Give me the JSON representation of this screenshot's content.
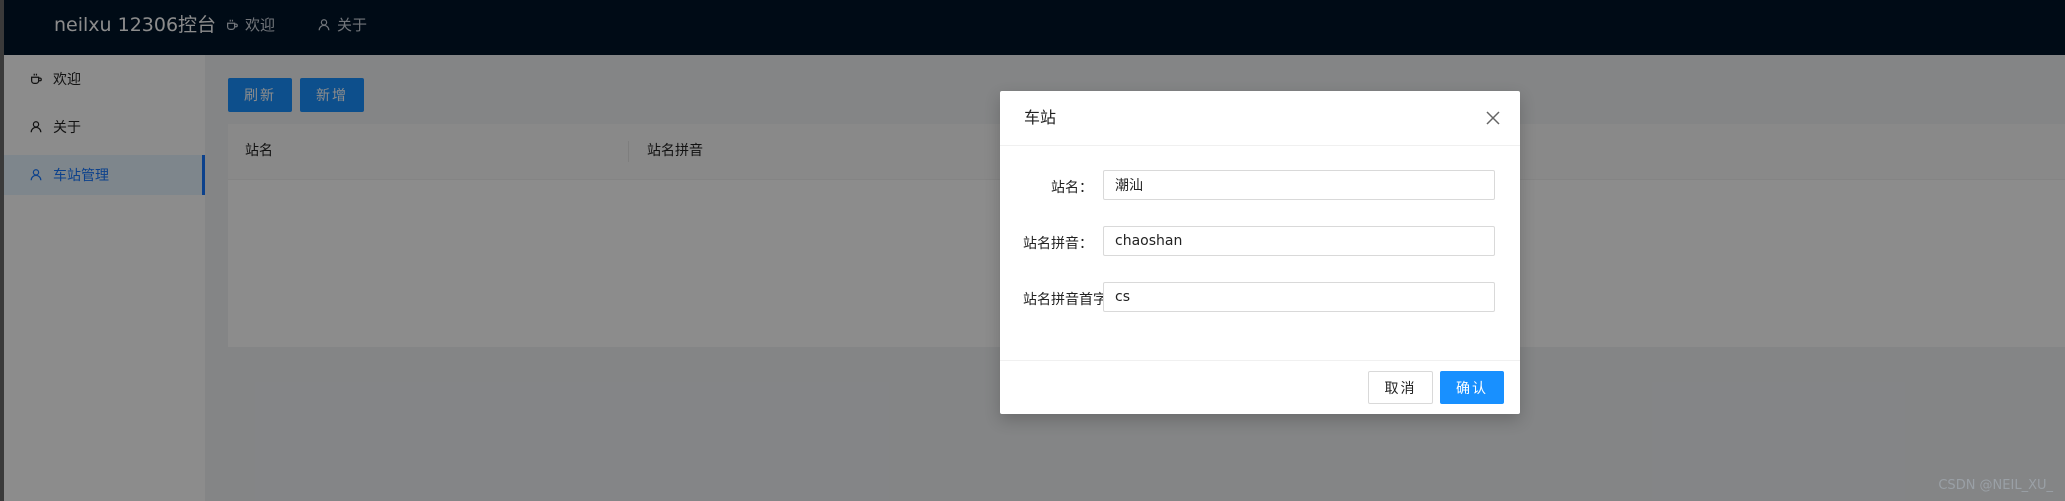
{
  "header": {
    "brand": "neilxu 12306控台",
    "nav": [
      {
        "label": "欢迎",
        "icon": "coffee-icon"
      },
      {
        "label": "关于",
        "icon": "user-icon"
      }
    ]
  },
  "sidebar": {
    "items": [
      {
        "label": "欢迎",
        "icon": "coffee-icon",
        "active": false
      },
      {
        "label": "关于",
        "icon": "user-icon",
        "active": false
      },
      {
        "label": "车站管理",
        "icon": "user-icon",
        "active": true
      }
    ]
  },
  "toolbar": {
    "refresh_label": "刷新",
    "add_label": "新增"
  },
  "table": {
    "columns": [
      "站名",
      "站名拼音"
    ]
  },
  "modal": {
    "title": "车站",
    "fields": [
      {
        "label": "站名：",
        "value": "潮汕"
      },
      {
        "label": "站名拼音：",
        "value": "chaoshan"
      },
      {
        "label": "站名拼音首字",
        "value": "cs"
      }
    ],
    "cancel_label": "取消",
    "ok_label": "确认"
  },
  "watermark": "CSDN @NEIL_XU_",
  "colors": {
    "header_bg": "#001529",
    "primary": "#1890ff",
    "active_menu_bg": "#e6f4ff"
  }
}
